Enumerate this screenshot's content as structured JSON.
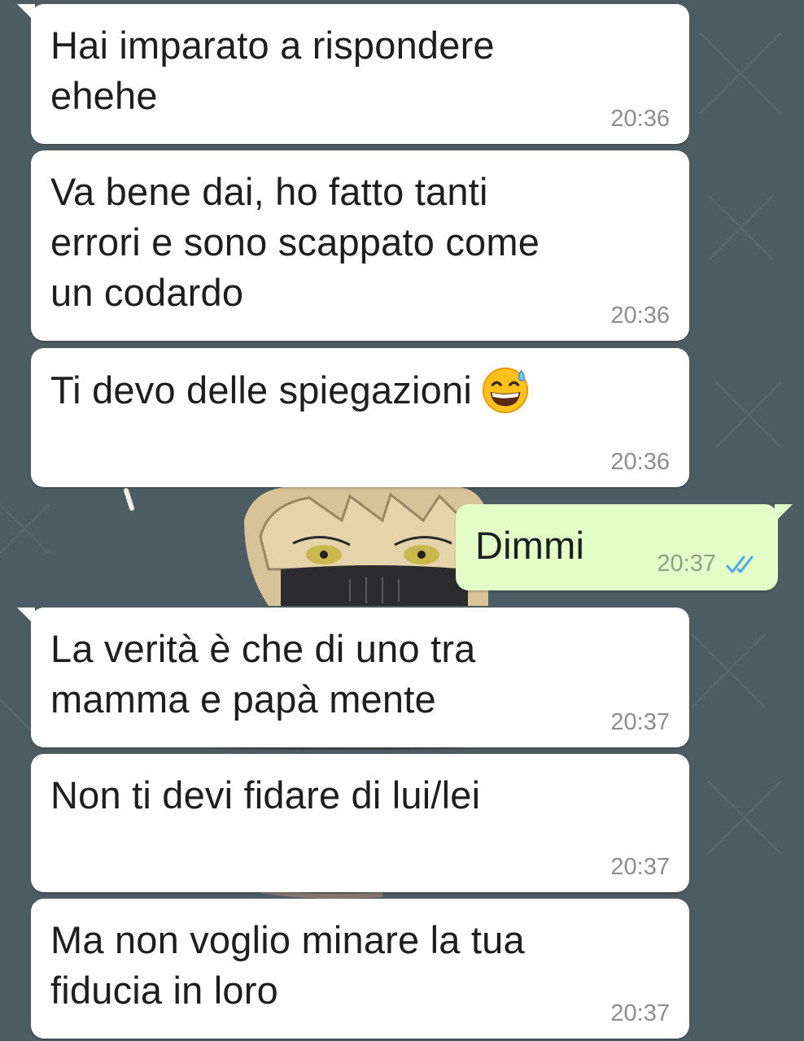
{
  "conversation": {
    "messages": [
      {
        "direction": "incoming",
        "text": "Hai imparato a rispondere\nehehe",
        "time": "20:36"
      },
      {
        "direction": "incoming",
        "text": "Va bene dai, ho fatto tanti\nerrori e sono scappato come\nun codardo",
        "time": "20:36"
      },
      {
        "direction": "incoming",
        "text": "Ti devo delle spiegazioni",
        "emoji": "grinning-face-with-sweat-icon",
        "time": "20:36"
      },
      {
        "direction": "outgoing",
        "text": "Dimmi",
        "time": "20:37",
        "status": "read-double-check-icon"
      },
      {
        "direction": "incoming",
        "text": "La verità è che di uno tra\nmamma e papà mente",
        "time": "20:37"
      },
      {
        "direction": "incoming",
        "text": "Non ti devi fidare di lui/lei",
        "time": "20:37"
      },
      {
        "direction": "incoming",
        "text": "Ma non voglio minare la tua\nfiducia in loro",
        "time": "20:37"
      }
    ]
  },
  "colors": {
    "wallpaper": "#4d5c63",
    "incoming_bubble": "#ffffff",
    "outgoing_bubble": "#e2fdc7",
    "read_ticks": "#4fa6e8"
  }
}
